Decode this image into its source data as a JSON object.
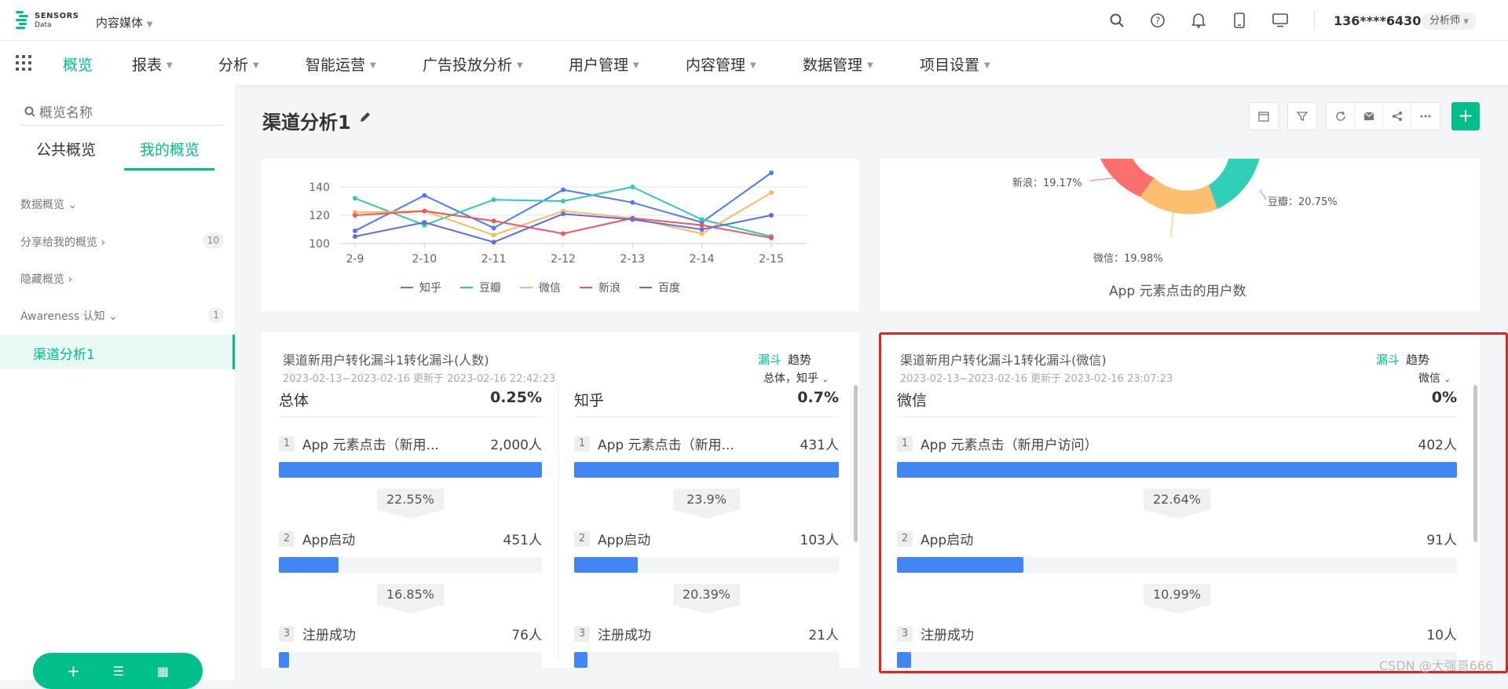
{
  "topbar": {
    "logo_line1": "SENSORS",
    "logo_line2": "Data",
    "project": "内容媒体",
    "user": "136****6430",
    "role": "分析师"
  },
  "nav": {
    "items": [
      "概览",
      "报表",
      "分析",
      "智能运营",
      "广告投放分析",
      "用户管理",
      "内容管理",
      "数据管理",
      "项目设置"
    ]
  },
  "sidebar": {
    "search_placeholder": "概览名称",
    "tabs": [
      "公共概览",
      "我的概览"
    ],
    "groups": [
      {
        "label": "数据概览",
        "count": ""
      },
      {
        "label": "分享给我的概览",
        "count": "10"
      },
      {
        "label": "隐藏概览",
        "count": ""
      },
      {
        "label": "Awareness 认知",
        "count": "1"
      }
    ],
    "active_item": "渠道分析1"
  },
  "page": {
    "title": "渠道分析1"
  },
  "chart_data": {
    "type": "line",
    "x": [
      "2-9",
      "2-10",
      "2-11",
      "2-12",
      "2-13",
      "2-14",
      "2-15"
    ],
    "y_ticks": [
      100,
      120,
      140
    ],
    "series": [
      {
        "name": "知乎",
        "color": "#4e7cf3",
        "values": [
          109,
          134,
          111,
          138,
          129,
          115,
          150
        ]
      },
      {
        "name": "豆瓣",
        "color": "#2ecbb0",
        "values": [
          132,
          113,
          131,
          130,
          140,
          117,
          105
        ]
      },
      {
        "name": "微信",
        "color": "#fcb960",
        "values": [
          122,
          123,
          106,
          123,
          118,
          107,
          136
        ]
      },
      {
        "name": "新浪",
        "color": "#f2555c",
        "values": [
          120,
          123,
          116,
          107,
          118,
          113,
          104
        ]
      },
      {
        "name": "百度",
        "color": "#5b6ee8",
        "values": [
          105,
          115,
          101,
          121,
          117,
          110,
          120
        ]
      }
    ]
  },
  "donut": {
    "caption": "App 元素点击的用户数",
    "labels": {
      "sina": "新浪：19.17%",
      "douban": "豆瓣：20.75%",
      "weixin": "微信：19.98%"
    }
  },
  "funnel_left": {
    "title": "渠道新用户转化漏斗1转化漏斗(人数)",
    "subtitle": "2023-02-13~2023-02-16 更新于 2023-02-16 22:42:23",
    "switch_active": "漏斗",
    "switch_other": "趋势",
    "select": "总体，知乎",
    "columns": [
      {
        "name": "总体",
        "pct": "0.25%",
        "steps": [
          {
            "n": "1",
            "name": "App 元素点击（新用...",
            "val": "2,000人",
            "ratio": 1.0
          },
          {
            "n": "2",
            "name": "App启动",
            "val": "451人",
            "ratio": 0.2255
          },
          {
            "n": "3",
            "name": "注册成功",
            "val": "76人",
            "ratio": 0.038
          }
        ],
        "rates": [
          "22.55%",
          "16.85%"
        ]
      },
      {
        "name": "知乎",
        "pct": "0.7%",
        "steps": [
          {
            "n": "1",
            "name": "App 元素点击（新用...",
            "val": "431人",
            "ratio": 1.0
          },
          {
            "n": "2",
            "name": "App启动",
            "val": "103人",
            "ratio": 0.239
          },
          {
            "n": "3",
            "name": "注册成功",
            "val": "21人",
            "ratio": 0.049
          }
        ],
        "rates": [
          "23.9%",
          "20.39%"
        ]
      }
    ]
  },
  "funnel_right": {
    "title": "渠道新用户转化漏斗1转化漏斗(微信)",
    "subtitle": "2023-02-13~2023-02-16 更新于 2023-02-16 23:07:23",
    "switch_active": "漏斗",
    "switch_other": "趋势",
    "select": "微信",
    "column": {
      "name": "微信",
      "pct": "0%",
      "steps": [
        {
          "n": "1",
          "name": "App 元素点击（新用户访问）",
          "val": "402人",
          "ratio": 1.0
        },
        {
          "n": "2",
          "name": "App启动",
          "val": "91人",
          "ratio": 0.2264
        },
        {
          "n": "3",
          "name": "注册成功",
          "val": "10人",
          "ratio": 0.025
        }
      ],
      "rates": [
        "22.64%",
        "10.99%"
      ]
    }
  },
  "watermark": "CSDN @大强哥666"
}
